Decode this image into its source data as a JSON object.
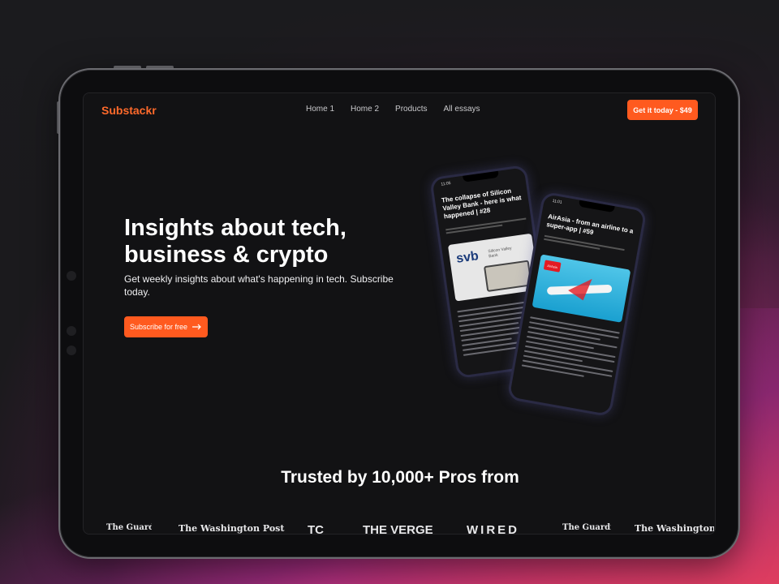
{
  "brand": {
    "logo": "Substackr"
  },
  "nav": {
    "links": [
      "Home 1",
      "Home 2",
      "Products",
      "All essays"
    ],
    "cta": "Get it today - $49"
  },
  "hero": {
    "title": "Insights about tech, business & crypto",
    "subtitle": "Get weekly insights about what's happening in tech. Subscribe today.",
    "button": "Subscribe for free"
  },
  "phones": [
    {
      "time": "11:05",
      "title": "The collapse of Silicon Valley Bank - here is what happened | #28",
      "image_text": "svb",
      "image_subtext": "Silicon Valley Bank"
    },
    {
      "time": "11:01",
      "title": "AirAsia - from an airline to a super-app | #59",
      "image_text": "AirAsia"
    }
  ],
  "trusted": {
    "heading": "Trusted by 10,000+ Pros from"
  },
  "publications": [
    "The Guardian",
    "The Washington Post",
    "TC",
    "THE VERGE",
    "WIRED",
    "The Guardian",
    "The Washington Post"
  ],
  "colors": {
    "accent": "#ff5a1f",
    "logo": "#ff6a2b",
    "background": "#121214"
  }
}
